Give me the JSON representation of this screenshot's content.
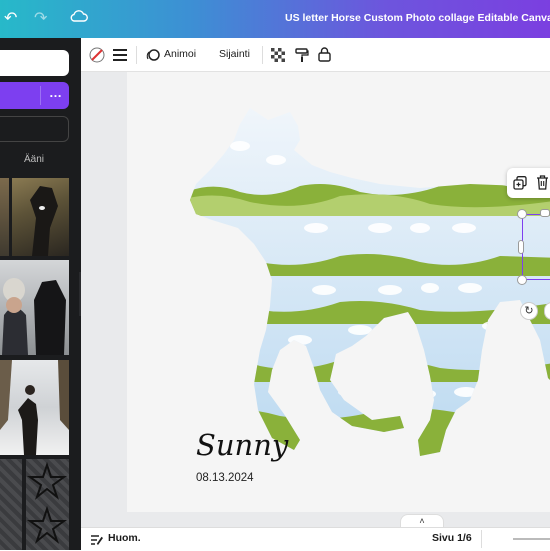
{
  "header": {
    "title": "US letter Horse Custom Photo collage Editable Canva Tem",
    "icons": [
      "undo-icon",
      "redo-icon",
      "cloud-save-icon"
    ]
  },
  "sidebar": {
    "tab_label": "Ääni",
    "more_label": "…"
  },
  "toolbar": {
    "animate_label": "Animoi",
    "position_label": "Sijainti"
  },
  "canvas": {
    "name_text": "Sunny",
    "date_text": "08.13.2024"
  },
  "bottombar": {
    "notes_label": "Huom.",
    "page_label": "Sivu 1/6"
  },
  "colors": {
    "accent": "#7d3ff0",
    "grass": "#8ab13a",
    "sky": "#cfe3f2"
  }
}
